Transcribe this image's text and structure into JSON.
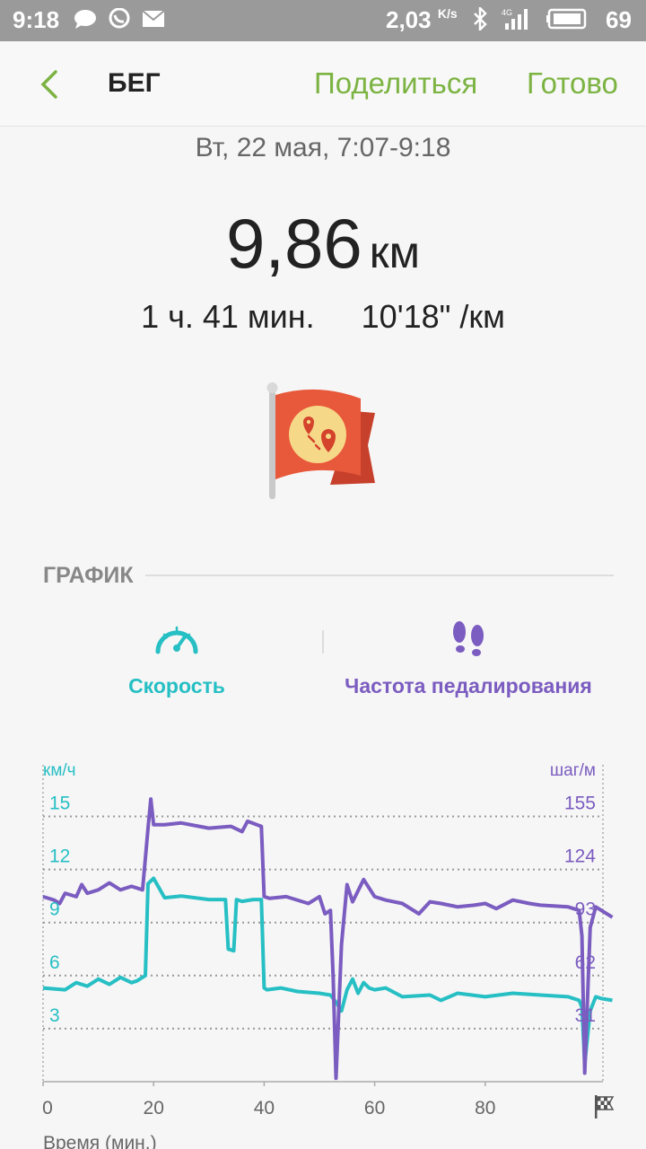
{
  "status_bar": {
    "time": "9:18",
    "speed": "2,03",
    "speed_unit": "K/s",
    "network": "4G",
    "battery": "69"
  },
  "header": {
    "back_icon": "chevron-left-icon",
    "title": "БЕГ",
    "share_label": "Поделиться",
    "done_label": "Готово",
    "accent_color": "#7cb342"
  },
  "workout": {
    "date": "Вт, 22 мая, 7:07-9:18",
    "distance": "9,86",
    "distance_unit": "км",
    "duration": "1 ч. 41 мин.",
    "pace": "10'18\" /км",
    "badge_icon": "route-flag-icon"
  },
  "graph_section": {
    "title": "ГРАФИК",
    "tabs": [
      {
        "label": "Скорость",
        "icon": "speedometer-icon",
        "color": "#26bfc4"
      },
      {
        "label": "Частота педалирования",
        "icon": "footprints-icon",
        "color": "#7b5cc0"
      }
    ]
  },
  "chart_data": {
    "type": "line",
    "xlabel": "Время (мин.)",
    "xlim": [
      0,
      103
    ],
    "x_ticks": [
      "0",
      "20",
      "40",
      "60",
      "80"
    ],
    "left_axis": {
      "unit": "км/ч",
      "ticks": [
        "15",
        "12",
        "9",
        "6",
        "3"
      ],
      "ylim": [
        0,
        15.5
      ]
    },
    "right_axis": {
      "unit": "шаг/м",
      "ticks": [
        "155",
        "124",
        "93",
        "62",
        "31"
      ],
      "ylim": [
        0,
        160
      ]
    },
    "grid": true,
    "series": [
      {
        "axis": "left",
        "color": "#26bfc4",
        "x": [
          0,
          4,
          6,
          8,
          10,
          12,
          14,
          16,
          17,
          18.5,
          19,
          20,
          22,
          25,
          30,
          33,
          33.5,
          34.5,
          35,
          36,
          38,
          39.5,
          40,
          40.5,
          43,
          46,
          50,
          52,
          53,
          54,
          55,
          56,
          57,
          58,
          59,
          60,
          62,
          65,
          70,
          72,
          75,
          80,
          85,
          90,
          95,
          97,
          97.5,
          98,
          99,
          100,
          101,
          103
        ],
        "values": [
          5.3,
          5.2,
          5.6,
          5.4,
          5.8,
          5.5,
          5.9,
          5.6,
          5.7,
          6.0,
          11.2,
          11.5,
          10.4,
          10.5,
          10.3,
          10.3,
          7.5,
          7.4,
          10.3,
          10.2,
          10.3,
          10.3,
          5.3,
          5.2,
          5.3,
          5.1,
          5.0,
          4.9,
          4.5,
          4.0,
          5.2,
          5.8,
          5.0,
          5.6,
          5.3,
          5.2,
          5.3,
          4.8,
          4.9,
          4.6,
          5.0,
          4.8,
          5.0,
          4.9,
          4.8,
          4.6,
          4.2,
          1.0,
          4.0,
          4.8,
          4.7,
          4.6
        ]
      },
      {
        "axis": "right",
        "color": "#7b5cc0",
        "x": [
          0,
          2,
          3,
          4,
          6,
          7,
          8,
          10,
          12,
          14,
          16,
          18,
          19,
          19.5,
          20,
          22,
          25,
          30,
          34,
          36,
          37,
          39.5,
          40,
          41,
          44,
          48,
          50,
          51,
          52,
          52.5,
          53,
          54,
          55,
          56,
          58,
          60,
          62,
          65,
          68,
          70,
          72,
          75,
          78,
          80,
          82,
          85,
          88,
          90,
          95,
          97,
          97.5,
          98,
          99,
          100,
          103
        ],
        "values": [
          108,
          106,
          104,
          110,
          108,
          115,
          110,
          112,
          116,
          112,
          114,
          112,
          148,
          165,
          150,
          150,
          151,
          148,
          149,
          146,
          152,
          149,
          108,
          107,
          108,
          104,
          108,
          98,
          100,
          60,
          2,
          80,
          115,
          105,
          118,
          108,
          106,
          104,
          98,
          105,
          104,
          102,
          103,
          104,
          101,
          106,
          104,
          103,
          102,
          100,
          85,
          5,
          90,
          102,
          96
        ]
      }
    ]
  },
  "chart_labels": {
    "left_unit": "км/ч",
    "right_unit": "шаг/м",
    "left_ticks": [
      "15",
      "12",
      "9",
      "6",
      "3"
    ],
    "right_ticks": [
      "155",
      "124",
      "93",
      "62",
      "31"
    ],
    "x_ticks": [
      "0",
      "20",
      "40",
      "60",
      "80"
    ],
    "xlabel": "Время (мин.)",
    "finish_icon": "checkered-flag-icon"
  }
}
